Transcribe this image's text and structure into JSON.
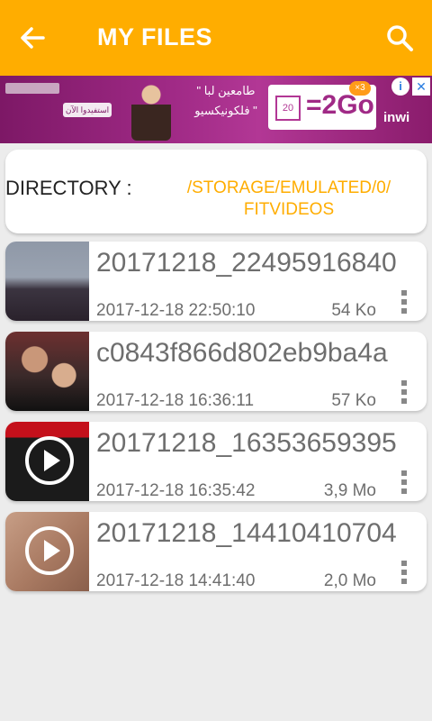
{
  "appbar": {
    "title": "MY FILES",
    "back_icon": "arrow-left-icon",
    "search_icon": "search-icon",
    "color": "#ffad00"
  },
  "ad": {
    "cta": "استفيدوا الآن",
    "headline": "\" طامعين لبا فلكونيكسيو \"",
    "offer_number": "20",
    "offer_big": "=2Go",
    "badge": "×3",
    "brand": "inwi",
    "info_icon": "info-icon",
    "close_icon": "close-icon"
  },
  "directory": {
    "label": "DIRECTORY :",
    "path": "/STORAGE/EMULATED/0/ FITVIDEOS",
    "path_color": "#ffad00"
  },
  "files": [
    {
      "name": "20171218_22495916840",
      "date": "2017-12-18 22:50:10",
      "size": "54 Ko",
      "thumb": "city-night-thumbnail"
    },
    {
      "name": "c0843f866d802eb9ba4a",
      "date": "2017-12-18 16:36:11",
      "size": "57 Ko",
      "thumb": "people-selfie-thumbnail"
    },
    {
      "name": "20171218_16353659395",
      "date": "2017-12-18 16:35:42",
      "size": "3,9 Mo",
      "thumb": "video-play-thumbnail"
    },
    {
      "name": "20171218_14410410704",
      "date": "2017-12-18 14:41:40",
      "size": "2,0 Mo",
      "thumb": "video-play-thumbnail"
    }
  ]
}
